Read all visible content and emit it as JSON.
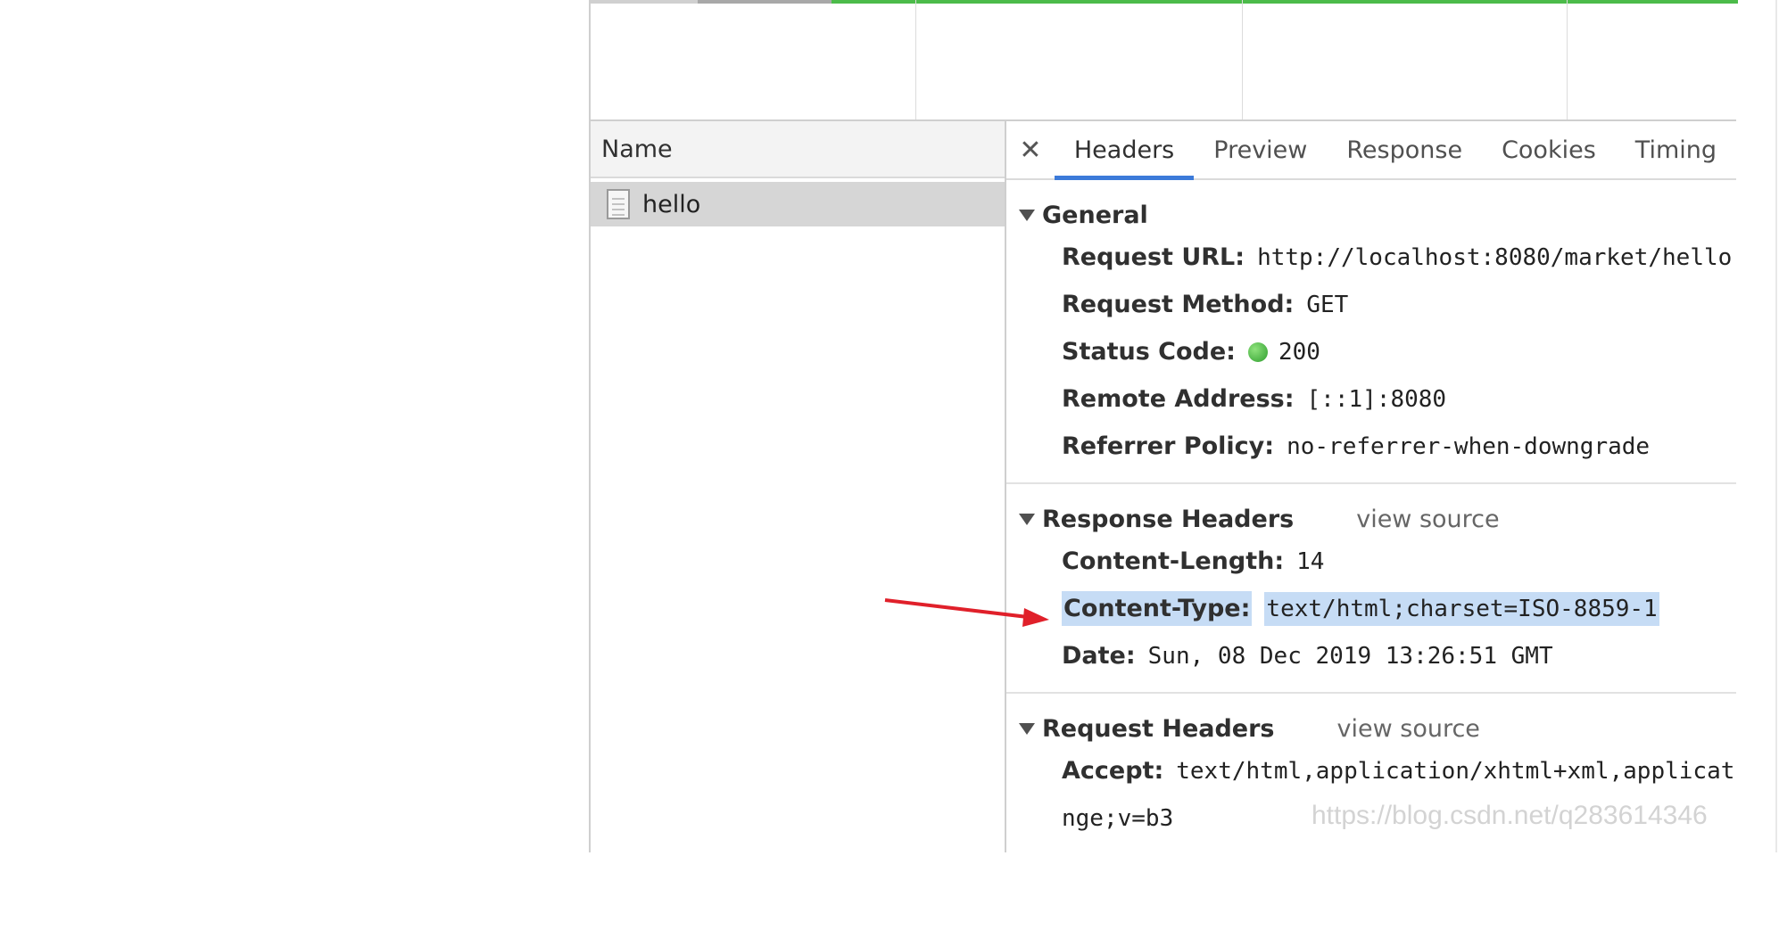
{
  "list": {
    "column_name": "Name",
    "rows": [
      {
        "name": "hello"
      }
    ]
  },
  "tabs": [
    "Headers",
    "Preview",
    "Response",
    "Cookies",
    "Timing"
  ],
  "active_tab": "Headers",
  "general": {
    "title": "General",
    "request_url_key": "Request URL:",
    "request_url": "http://localhost:8080/market/hello",
    "request_method_key": "Request Method:",
    "request_method": "GET",
    "status_code_key": "Status Code:",
    "status_code": "200",
    "remote_address_key": "Remote Address:",
    "remote_address": "[::1]:8080",
    "referrer_policy_key": "Referrer Policy:",
    "referrer_policy": "no-referrer-when-downgrade"
  },
  "response_headers": {
    "title": "Response Headers",
    "view_source": "view source",
    "content_length_key": "Content-Length:",
    "content_length": "14",
    "content_type_key": "Content-Type:",
    "content_type": "text/html;charset=ISO-8859-1",
    "date_key": "Date:",
    "date": "Sun, 08 Dec 2019 13:26:51 GMT"
  },
  "request_headers": {
    "title": "Request Headers",
    "view_source": "view source",
    "accept_key": "Accept:",
    "accept": "text/html,application/xhtml+xml,applicat",
    "accept_cont": "nge;v=b3"
  },
  "watermark": "https://blog.csdn.net/q283614346",
  "colors": {
    "active_tab_underline": "#3c7ad9",
    "status_ok": "#2e9e2e",
    "highlight": "#c6dcf5",
    "annotation_arrow": "#e0202a"
  }
}
